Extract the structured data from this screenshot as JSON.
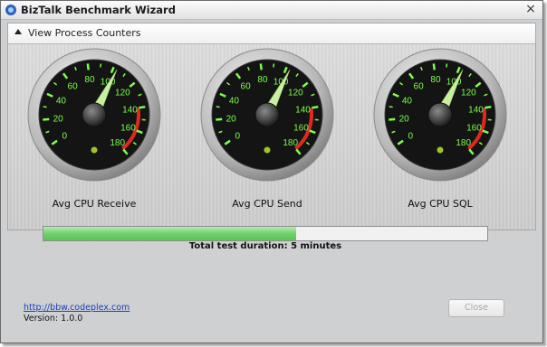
{
  "window": {
    "title": "BizTalk Benchmark Wizard",
    "close_glyph": "×"
  },
  "expander": {
    "label": "View Process Counters",
    "expanded": true
  },
  "gauges": [
    {
      "label": "Avg CPU Receive",
      "value": 103
    },
    {
      "label": "Avg CPU Send",
      "value": 103
    },
    {
      "label": "Avg CPU SQL",
      "value": 103
    }
  ],
  "gauge_scale": {
    "min": 0,
    "max": 180,
    "ticks": [
      "0",
      "20",
      "40",
      "60",
      "80",
      "100",
      "120",
      "140",
      "160",
      "180"
    ],
    "red_zone_start": 140
  },
  "progress": {
    "fraction": 0.57,
    "caption": "Total test duration: 5 minutes"
  },
  "footer": {
    "link": "http://bbw.codeplex.com",
    "version": "Version: 1.0.0",
    "close_label": "Close",
    "close_enabled": false
  },
  "colors": {
    "gauge_face": "#141414",
    "gauge_tick": "#7cff4a",
    "gauge_red": "#e02a1e",
    "needle": "#c8f0a0",
    "progress": "#6fd06a"
  },
  "icons": {
    "app": "biztalk-app-icon",
    "expander": "collapse-arrow-up-icon"
  }
}
